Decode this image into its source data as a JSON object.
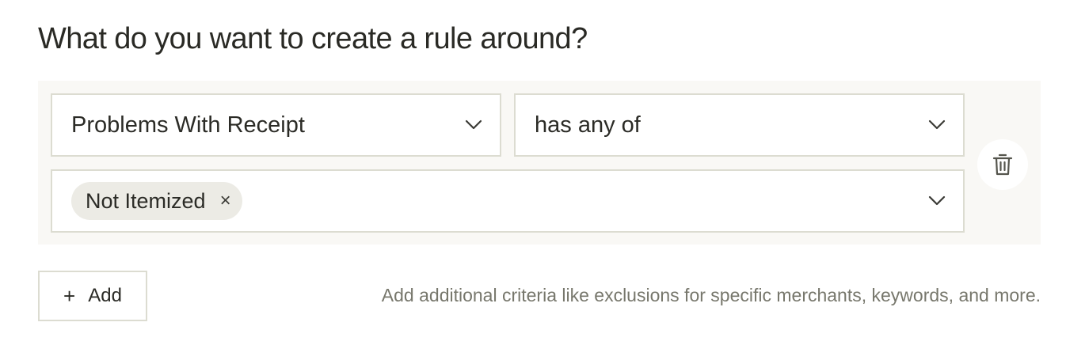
{
  "heading": "What do you want to create a rule around?",
  "rule": {
    "criterion": {
      "value": "Problems With Receipt",
      "icon": "chevron-down-icon"
    },
    "operator": {
      "value": "has any of",
      "icon": "chevron-down-icon"
    },
    "values": {
      "chips": [
        {
          "label": "Not Itemized",
          "remove_icon": "close-icon",
          "remove_glyph": "×"
        }
      ],
      "icon": "chevron-down-icon"
    },
    "delete_icon": "trash-icon"
  },
  "add_button": {
    "glyph": "+",
    "label": "Add"
  },
  "hint": "Add additional criteria like exclusions for specific merchants, keywords, and more.",
  "colors": {
    "card_background": "#f9f8f5",
    "border": "#dcdcd1",
    "chip_background": "#ecebe5",
    "text": "#2b2b26",
    "muted_text": "#77776c"
  }
}
